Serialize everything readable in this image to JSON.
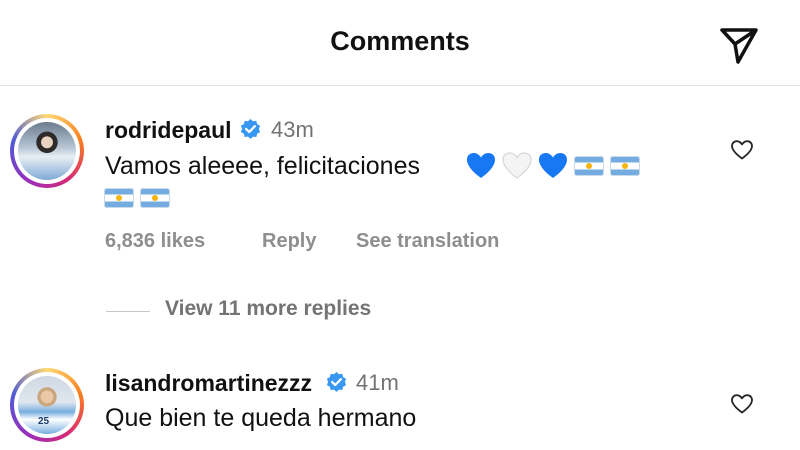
{
  "header": {
    "title": "Comments",
    "share_icon": "paper-plane-icon"
  },
  "comments": [
    {
      "username": "rodridepaul",
      "verified": true,
      "time": "43m",
      "text": "Vamos aleeee, felicitaciones",
      "emojis": [
        "blue-heart",
        "white-heart",
        "blue-heart",
        "argentina-flag",
        "argentina-flag",
        "argentina-flag",
        "argentina-flag"
      ],
      "likes": "6,836 likes",
      "reply_label": "Reply",
      "translate_label": "See translation",
      "view_replies": "View 11 more replies"
    },
    {
      "username": "lisandromartinezzz",
      "verified": true,
      "time": "41m",
      "text": "Que bien te queda hermano",
      "avatar_number": "25"
    }
  ],
  "colors": {
    "verified": "#3897f0",
    "heart_blue": "#1877f2",
    "muted": "#8e8e8e"
  }
}
